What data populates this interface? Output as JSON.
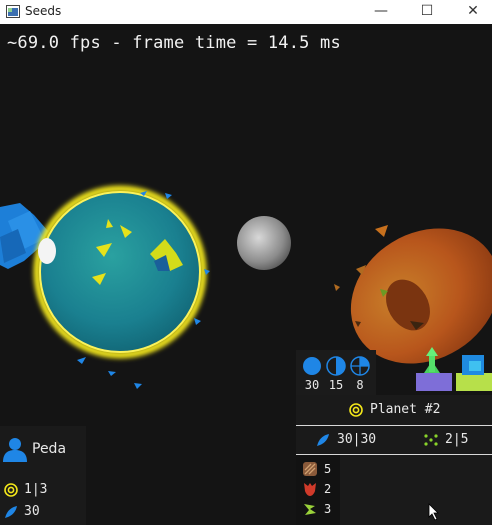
{
  "window": {
    "title": "Seeds",
    "minimize_glyph": "—",
    "maximize_glyph": "☐",
    "close_glyph": "✕"
  },
  "hud": {
    "fps_text": "~69.0 fps - frame time = 14.5 ms"
  },
  "resources": [
    {
      "icon": "full-circle-icon",
      "value": "30"
    },
    {
      "icon": "half-circle-icon",
      "value": "15"
    },
    {
      "icon": "crosshair-circle-icon",
      "value": "8"
    }
  ],
  "planet_panel": {
    "name": "Planet #2",
    "seeds": "30|30",
    "growth": "2|5",
    "units": [
      {
        "icon": "brown-unit-icon",
        "count": "5"
      },
      {
        "icon": "red-unit-icon",
        "count": "2"
      },
      {
        "icon": "green-unit-icon",
        "count": "3"
      }
    ]
  },
  "player": {
    "name": "Peda",
    "planets": "1|3",
    "seeds": "30"
  },
  "colors": {
    "accent_yellow": "#f2e61a",
    "seed_blue": "#1f86e6",
    "planet_teal": "#1e8a95",
    "planet_orange": "#c46a1e"
  }
}
